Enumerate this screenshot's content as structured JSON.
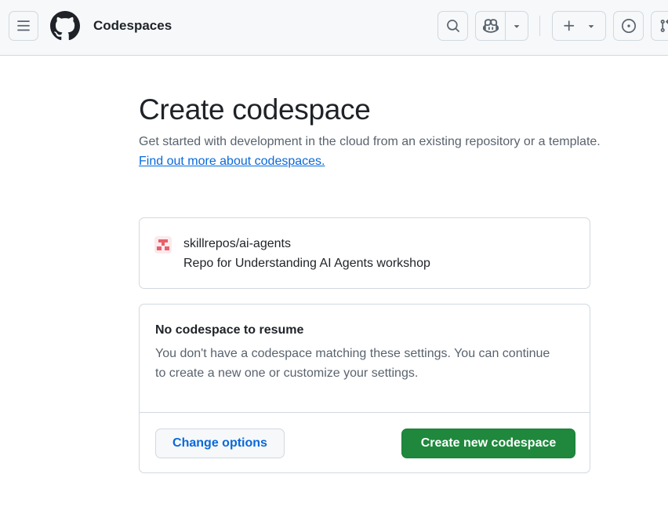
{
  "header": {
    "app_title": "Codespaces",
    "icons": {
      "menu": "hamburger-menu-icon",
      "logo": "github-logo-icon",
      "search": "search-icon",
      "copilot": "copilot-icon",
      "copilot_dropdown": "triangle-down-icon",
      "create": "plus-icon",
      "create_dropdown": "triangle-down-icon",
      "issues": "issue-opened-icon",
      "pull_requests": "git-pull-request-icon"
    }
  },
  "main": {
    "title": "Create codespace",
    "subtitle": "Get started with development in the cloud from an existing repository or a template.",
    "subtitle_link": "Find out more about codespaces."
  },
  "repo": {
    "name": "skillrepos/ai-agents",
    "description": "Repo for Understanding AI Agents workshop",
    "avatar_icon": "repo-owner-avatar"
  },
  "status": {
    "title": "No codespace to resume",
    "body": "You don't have a codespace matching these settings. You can continue to create a new one or customize your settings.",
    "change_options_label": "Change options",
    "create_label": "Create new codespace"
  },
  "colors": {
    "header_bg": "#f6f8fa",
    "border": "#d1d9e0",
    "link": "#0969da",
    "primary_button": "#1f883d",
    "muted_text": "#59636e",
    "avatar": "#e8606b"
  }
}
